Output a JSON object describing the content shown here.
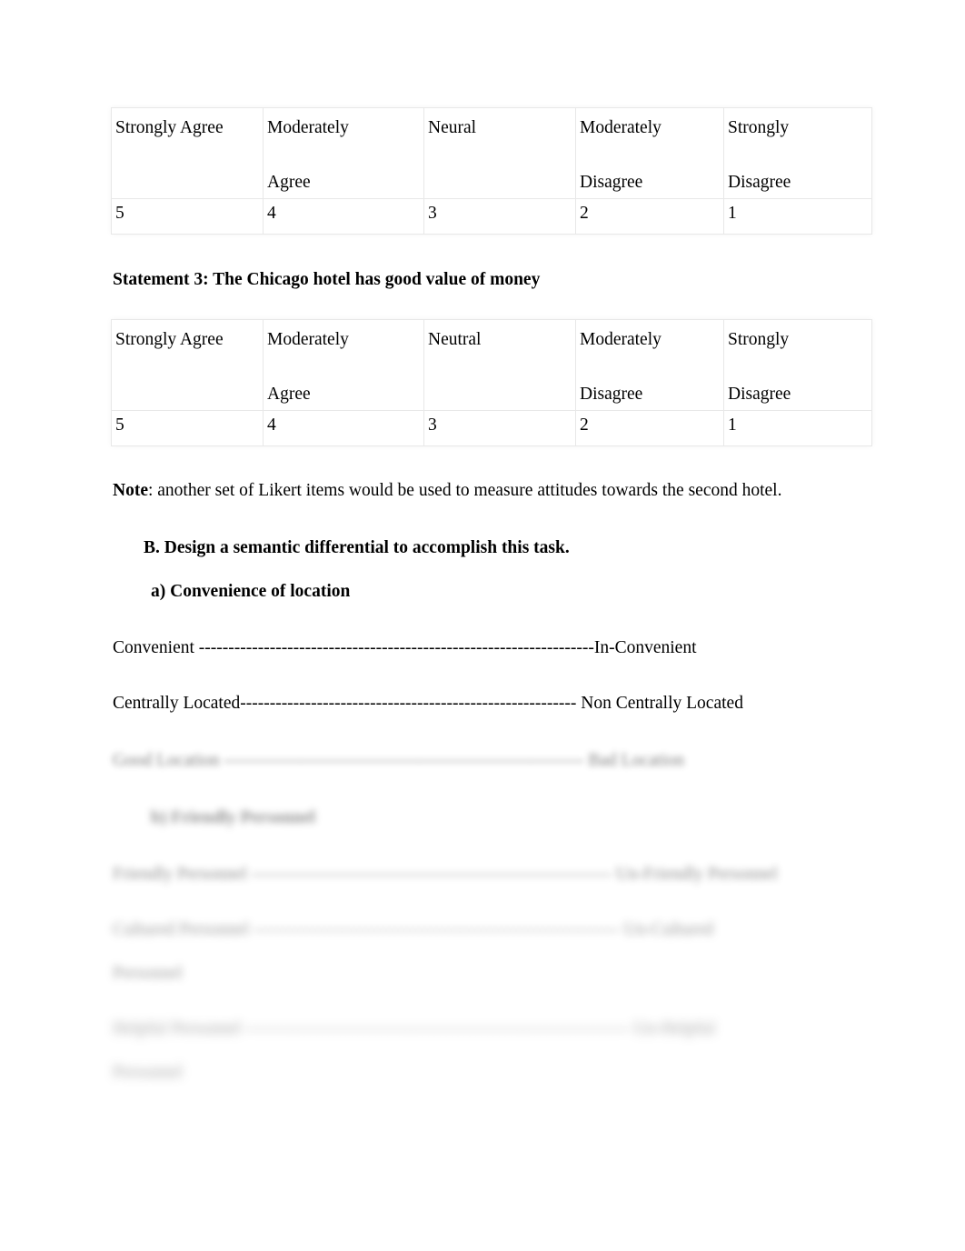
{
  "document": {
    "tables": [
      {
        "id": "table-1",
        "columns": [
          {
            "label_top": "Strongly Agree",
            "label_bottom": "",
            "value": "5"
          },
          {
            "label_top": "Moderately",
            "label_bottom": "Agree",
            "value": "4"
          },
          {
            "label_top": "Neural",
            "label_bottom": "",
            "value": "3"
          },
          {
            "label_top": "Moderately",
            "label_bottom": "Disagree",
            "value": "2"
          },
          {
            "label_top": "Strongly",
            "label_bottom": "Disagree",
            "value": "1"
          }
        ]
      },
      {
        "id": "table-2",
        "columns": [
          {
            "label_top": "Strongly Agree",
            "label_bottom": "",
            "value": "5"
          },
          {
            "label_top": "Moderately",
            "label_bottom": "Agree",
            "value": "4"
          },
          {
            "label_top": "Neutral",
            "label_bottom": "",
            "value": "3"
          },
          {
            "label_top": "Moderately",
            "label_bottom": "Disagree",
            "value": "2"
          },
          {
            "label_top": "Strongly",
            "label_bottom": "Disagree",
            "value": "1"
          }
        ]
      }
    ],
    "statement_3": "Statement 3: The Chicago hotel has good value of money",
    "note": {
      "label": "Note",
      "rest": ": another set of Likert items would be used to measure attitudes towards the second hotel."
    },
    "heading_b": "B.  Design a semantic differential to accomplish this task.",
    "heading_a": "a)  Convenience of location",
    "heading_c": "b)  Friendly Personnel",
    "scales": [
      {
        "left": "Convenient ",
        "dashes": "-------------------------------------------------------------------",
        "right": "In-Convenient"
      },
      {
        "left": "Centrally Located",
        "dashes": "---------------------------------------------------------",
        "right": " Non Centrally Located"
      },
      {
        "left": "Good Location ",
        "dashes": "-------------------------------------------------------------",
        "right": " Bad Location"
      },
      {
        "left": "Friendly Personnel ",
        "dashes": "-------------------------------------------------------------",
        "right": " Un-Friendly Personnel"
      },
      {
        "left": "Cultured Personnel ",
        "dashes": "--------------------------------------------------------------",
        "right": " Un-Cultured",
        "wrap": "Personnel"
      },
      {
        "left": "Helpful Personnel ",
        "dashes": "-----------------------------------------------------------------",
        "right": " Un-Helpful",
        "wrap": "Personnel"
      }
    ]
  }
}
